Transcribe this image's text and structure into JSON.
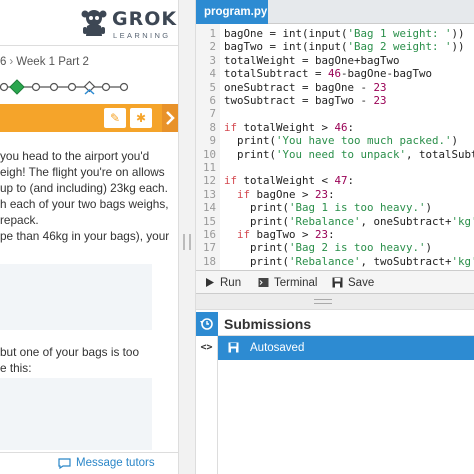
{
  "brand": {
    "name": "GROK",
    "tagline": "LEARNING"
  },
  "breadcrumb": {
    "prev": "6",
    "current": "Week 1 Part 2"
  },
  "progress": {
    "steps": 7,
    "current_index": 1
  },
  "lesson": {
    "paragraph1": [
      "you head to the airport you'd",
      "eigh! The flight you're on allows",
      "up to (and including) 23kg each.",
      "h each of your two bags weighs,",
      "repack."
    ],
    "paragraph2": "pe than 46kg in your bags), your",
    "paragraph3": [
      " but one of your bags is too",
      "e this:"
    ]
  },
  "message_tutors": "Message tutors",
  "editor": {
    "tab": "program.py",
    "lines": [
      {
        "n": "1",
        "html": "bagOne = int(input(<span class=\"str\">'Bag 1 weight: '</span>))"
      },
      {
        "n": "2",
        "html": "bagTwo = int(input(<span class=\"str\">'Bag 2 weight: '</span>))"
      },
      {
        "n": "3",
        "html": "totalWeight = bagOne+bagTwo"
      },
      {
        "n": "4",
        "html": "totalSubtract = <span class=\"num\">46</span>-bagOne-bagTwo"
      },
      {
        "n": "5",
        "html": "oneSubtract = bagOne - <span class=\"num\">23</span>"
      },
      {
        "n": "6",
        "html": "twoSubtract = bagTwo - <span class=\"num\">23</span>"
      },
      {
        "n": "7",
        "html": ""
      },
      {
        "n": "8",
        "html": "<span class=\"kw\">if</span> totalWeight > <span class=\"num\">46</span>:"
      },
      {
        "n": "9",
        "html": "  print(<span class=\"str\">'You have too much packed.'</span>)"
      },
      {
        "n": "10",
        "html": "  print(<span class=\"str\">'You need to unpack'</span>, totalSubtract+<span class=\"str\">'</span>"
      },
      {
        "n": "11",
        "html": ""
      },
      {
        "n": "12",
        "html": "<span class=\"kw\">if</span> totalWeight < <span class=\"num\">47</span>:"
      },
      {
        "n": "13",
        "html": "  <span class=\"kw\">if</span> bagOne > <span class=\"num\">23</span>:"
      },
      {
        "n": "14",
        "html": "    print(<span class=\"str\">'Bag 1 is too heavy.'</span>)"
      },
      {
        "n": "15",
        "html": "    print(<span class=\"str\">'Rebalance'</span>, oneSubtract+<span class=\"str\">'kg'</span>, <span class=\"str\">'ir</span>"
      },
      {
        "n": "16",
        "html": "  <span class=\"kw\">if</span> bagTwo > <span class=\"num\">23</span>:"
      },
      {
        "n": "17",
        "html": "    print(<span class=\"str\">'Bag 2 is too heavy.'</span>)"
      },
      {
        "n": "18",
        "html": "    print(<span class=\"str\">'Rebalance'</span>, twoSubtract+<span class=\"str\">'kg'</span>, <span class=\"str\">'ir</span>"
      }
    ]
  },
  "runbar": {
    "run": "Run",
    "terminal": "Terminal",
    "save": "Save"
  },
  "submissions": {
    "title": "Submissions",
    "item": "Autosaved"
  },
  "colors": {
    "accent": "#2d8bd2",
    "orange": "#f5a42a",
    "green": "#2aa64e"
  }
}
